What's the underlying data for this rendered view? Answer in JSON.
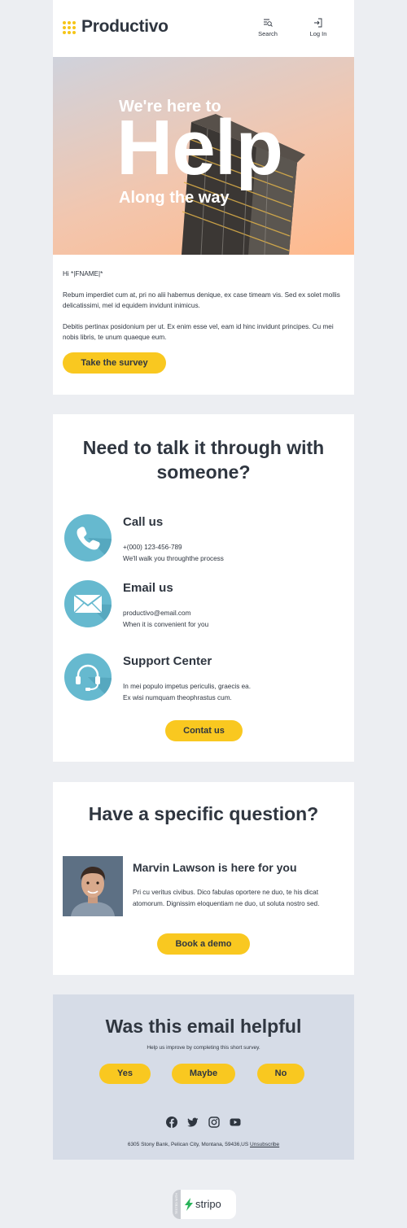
{
  "header": {
    "brand": "Productivo",
    "search_label": "Search",
    "login_label": "Log In"
  },
  "hero": {
    "line1": "We're here to",
    "big": "Help",
    "line2": "Along the way"
  },
  "intro": {
    "greeting": "Hi *|FNAME|*",
    "para1": "Rebum imperdiet cum at, pri no alii habemus denique, ex case timeam vis. Sed ex solet mollis delicatissimi, mel id equidem invidunt inimicus.",
    "para2": "Debitis pertinax posidonium per ut. Ex enim esse vel, eam id hinc invidunt principes. Cu mei nobis libris, te unum quaeque eum.",
    "button": "Take the survey"
  },
  "contact": {
    "heading": "Need to talk it through with someone?",
    "items": [
      {
        "icon": "phone-icon",
        "title": "Call us",
        "line1": "+(000) 123-456-789",
        "line2": "We'll walk you throughthe process"
      },
      {
        "icon": "email-icon",
        "title": "Email us",
        "line1": "productivo@email.com",
        "line2": "When it is convenient for you"
      },
      {
        "icon": "headset-icon",
        "title": "Support Center",
        "line1": "In mei populo impetus periculis, graecis ea.",
        "line2": "Ex wisi numquam theophrastus cum."
      }
    ],
    "button": "Contat us"
  },
  "question": {
    "heading": "Have a specific question?",
    "person_title": "Marvin Lawson is here for you",
    "text": "Pri cu veritus civibus. Dico fabulas oportere ne duo, te his dicat atomorum. Dignissim eloquentiam ne duo, ut soluta nostro sed.",
    "button": "Book a demo"
  },
  "feedback": {
    "heading": "Was this email helpful",
    "sub": "Help us improve by completing this short survey.",
    "options": [
      "Yes",
      "Maybe",
      "No"
    ],
    "social_icons": [
      "facebook-icon",
      "twitter-icon",
      "instagram-icon",
      "youtube-icon"
    ],
    "address": "6305 Stony Bank, Pelican City, Montana, 59436,US",
    "unsubscribe": "Unsubscribe"
  },
  "footer": {
    "badge_small": "TESTED WITH",
    "badge": "stripo"
  },
  "colors": {
    "accent": "#f9c820",
    "icon_circle": "#66b9cf",
    "background": "#eceef2",
    "feedback_bg": "#d6dce7"
  }
}
